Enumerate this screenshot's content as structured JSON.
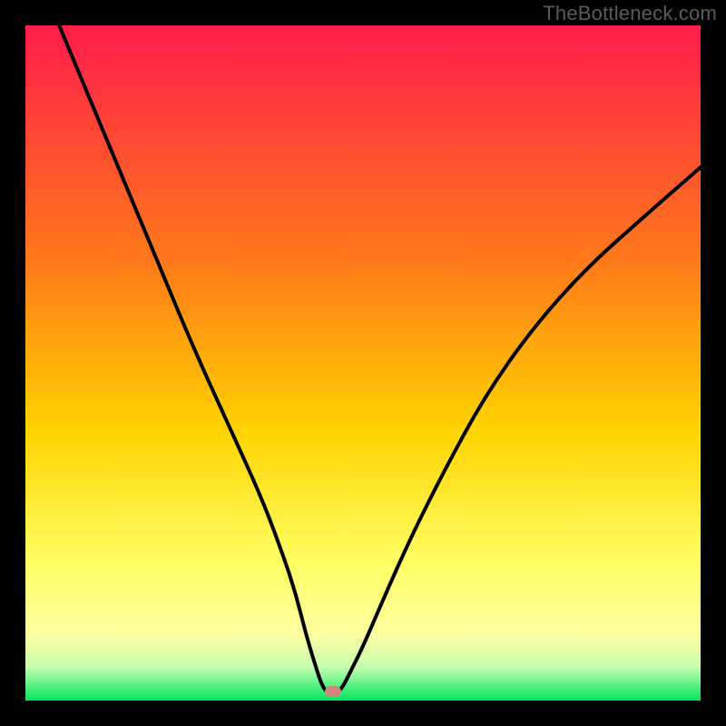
{
  "watermark": "TheBottleneck.com",
  "colors": {
    "background_frame": "#000000",
    "gradient_top": "#ff1c4b",
    "gradient_mid1": "#ff7a1a",
    "gradient_mid2": "#ffd400",
    "gradient_mid3": "#ffff66",
    "gradient_bottom": "#00e561",
    "curve": "#000000",
    "marker": "#d1877e",
    "watermark_text": "#5b5b5b"
  },
  "chart_data": {
    "type": "line",
    "title": "",
    "xlabel": "",
    "ylabel": "",
    "xlim": [
      0,
      100
    ],
    "ylim": [
      0,
      100
    ],
    "grid": false,
    "legend_position": "none",
    "series": [
      {
        "name": "bottleneck-curve",
        "x": [
          5,
          10,
          15,
          20,
          25,
          30,
          35,
          38,
          40,
          41.5,
          43,
          44,
          45,
          46,
          47,
          48,
          50,
          53,
          57,
          62,
          68,
          75,
          83,
          92,
          100
        ],
        "y": [
          100,
          88,
          76,
          64,
          52,
          41,
          30,
          22,
          16,
          10,
          5,
          2,
          1,
          1,
          2,
          4,
          8,
          15,
          24,
          34,
          45,
          55,
          64,
          72,
          79
        ]
      }
    ],
    "annotations": [
      {
        "name": "optimal-marker",
        "x": 45.5,
        "y": 1.4
      }
    ],
    "background_gradient_stops": [
      {
        "pos": 0.0,
        "color": "#ff1c4b"
      },
      {
        "pos": 0.35,
        "color": "#ff7a1a"
      },
      {
        "pos": 0.6,
        "color": "#ffd400"
      },
      {
        "pos": 0.8,
        "color": "#ffff66"
      },
      {
        "pos": 0.9,
        "color": "#ffffa0"
      },
      {
        "pos": 0.95,
        "color": "#c7ffb0"
      },
      {
        "pos": 1.0,
        "color": "#00e561"
      }
    ]
  }
}
